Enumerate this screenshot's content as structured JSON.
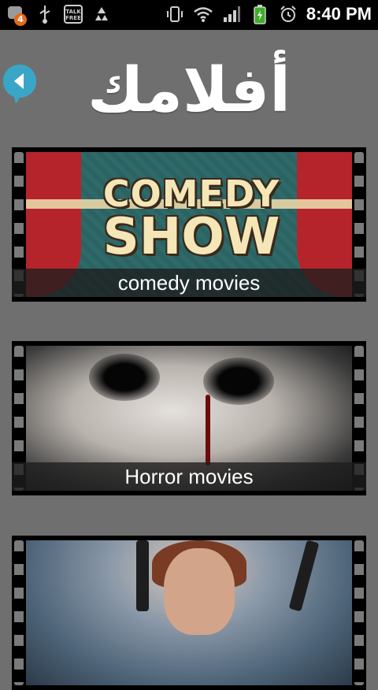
{
  "status_bar": {
    "notification_count": "4",
    "talk_free_label": "TALK\nFREE",
    "time": "8:40 PM",
    "icons": [
      "notification-icon",
      "usb-icon",
      "talk-free-icon",
      "recycle-icon",
      "vibrate-icon",
      "wifi-icon",
      "signal-icon",
      "battery-icon",
      "alarm-icon"
    ]
  },
  "header": {
    "title": "أفلامك",
    "back_icon": "back-arrow-icon"
  },
  "categories": [
    {
      "caption": "comedy movies",
      "poster_text_1": "COMEDY",
      "poster_text_2": "SHOW"
    },
    {
      "caption": "Horror movies"
    },
    {
      "caption": ""
    }
  ],
  "colors": {
    "background": "#6f6f6f",
    "back_button": "#3aa6c7",
    "status_bar": "#000000",
    "badge": "#e36a1c"
  }
}
